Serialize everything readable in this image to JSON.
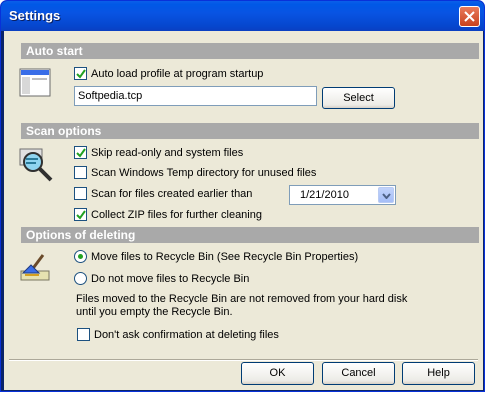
{
  "window": {
    "title": "Settings"
  },
  "auto_start": {
    "header": "Auto start",
    "auto_load": {
      "label": "Auto load profile at program startup",
      "checked": true
    },
    "profile_path": "Softpedia.tcp",
    "select_label": "Select"
  },
  "scan_options": {
    "header": "Scan options",
    "items": [
      {
        "label": "Skip read-only and system files",
        "checked": true
      },
      {
        "label": "Scan Windows Temp directory for unused files",
        "checked": false
      },
      {
        "label": "Scan for files created earlier than",
        "checked": false
      },
      {
        "label": "Collect ZIP files for further cleaning",
        "checked": true
      }
    ],
    "date_value": "1/21/2010"
  },
  "deleting": {
    "header": "Options of deleting",
    "radio_1": {
      "label": "Move files to Recycle Bin (See Recycle Bin Properties)",
      "selected": true
    },
    "radio_2": {
      "label": "Do not move files to Recycle Bin",
      "selected": false
    },
    "note_line1": "Files moved to the Recycle Bin are not removed from your hard disk",
    "note_line2": "until you empty the Recycle Bin.",
    "confirm": {
      "label": "Don't ask confirmation at deleting files",
      "checked": false
    }
  },
  "buttons": {
    "ok": "OK",
    "cancel": "Cancel",
    "help": "Help"
  },
  "colors": {
    "title_bar": "#0054e3",
    "header_gray": "#a9a9a9",
    "dialog_bg": "#ece9d8",
    "close_red": "#c8411d"
  }
}
